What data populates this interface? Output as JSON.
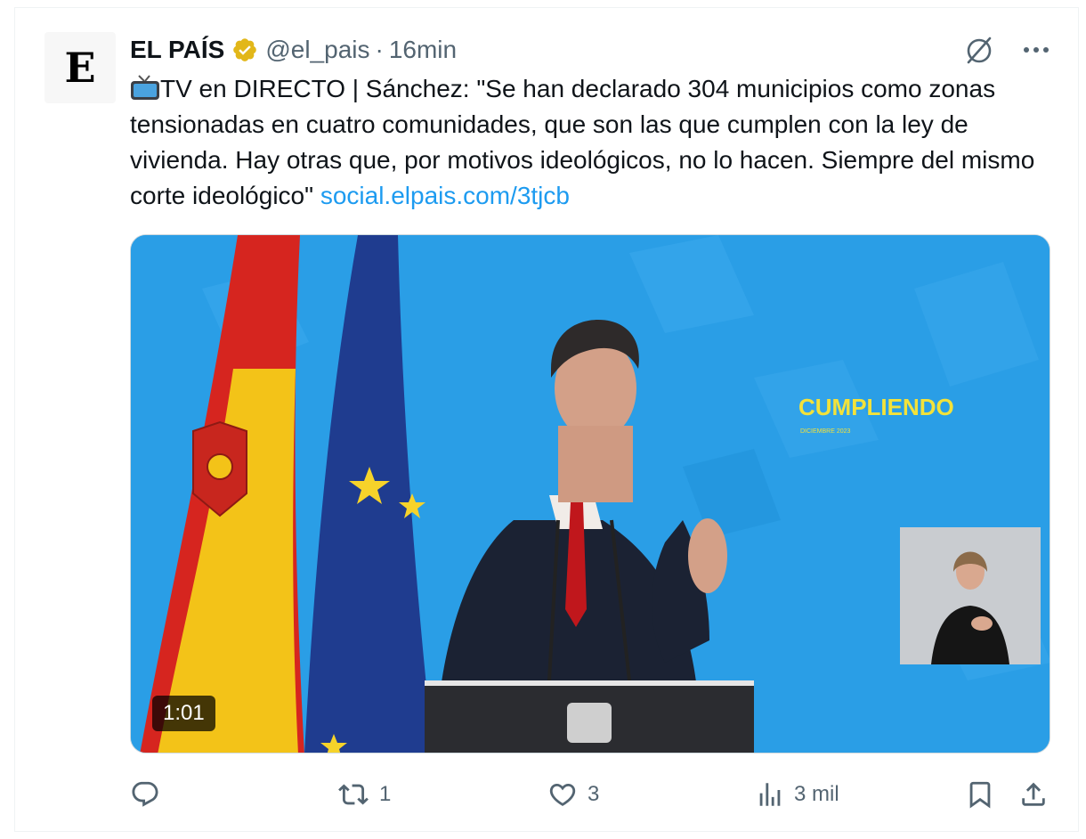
{
  "author": {
    "name": "EL PAÍS",
    "handle": "@el_pais",
    "separator": "·",
    "time": "16min",
    "avatar_letter": "E"
  },
  "tweet": {
    "text": "TV en DIRECTO | Sánchez: \"Se han declarado 304 municipios como zonas tensionadas en cuatro comunidades, que son las que cumplen con la ley de vivienda. Hay otras que, por motivos ideológicos, no lo hacen. Siempre del mismo corte ideológico\"",
    "link": "social.elpais.com/3tjcb"
  },
  "media": {
    "duration": "1:01",
    "backdrop_text": "CUMPLIENDO",
    "backdrop_subtext": "DICIEMBRE 2023"
  },
  "actions": {
    "reply_count": "",
    "retweet_count": "1",
    "like_count": "3",
    "views_count": "3 mil"
  },
  "colors": {
    "link": "#1d9bf0",
    "muted": "#536471",
    "verified": "#e2b719",
    "backdrop": "#2a9ee6"
  },
  "icons": [
    "verified-badge-icon",
    "grok-icon",
    "more-icon",
    "reply-icon",
    "retweet-icon",
    "like-icon",
    "views-icon",
    "bookmark-icon",
    "share-icon"
  ]
}
